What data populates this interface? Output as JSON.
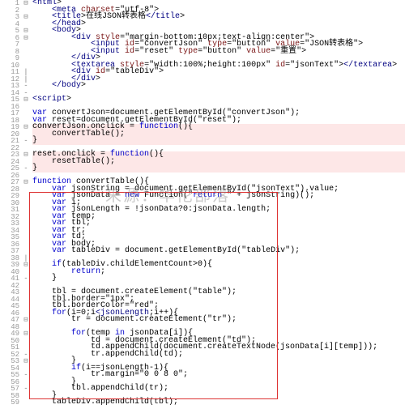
{
  "watermark": "来源：华佗部落",
  "gutter_max": 59,
  "fold_markers": {
    "1": "⊟",
    "3": "⊟",
    "5": "⊟",
    "6": "⊟",
    "11": "|",
    "12": "|",
    "13": "-",
    "14": "-",
    "15": "⊟",
    "19": "⊟",
    "21": "-",
    "23": "⊟",
    "25": "-",
    "27": "⊟",
    "38": "|",
    "39": "⊟",
    "41": "-",
    "47": "⊟",
    "49": "⊟",
    "52": "-",
    "53": "⊟",
    "55": "-",
    "57": "-"
  },
  "highlight_lines": [
    19,
    20,
    21,
    23,
    24,
    25
  ],
  "code": {
    "1": "<html>",
    "2": "    <meta charset=\"utf-8\">",
    "3": "    <title>在线JSON转表格</title>",
    "4": "    </head>",
    "5": "    <body>",
    "6": "        <div style=\"margin-bottom:10px;text-align:center\">",
    "7": "            <input id=\"convertJson\" type=\"button\" value=\"JSON转表格\">",
    "8": "            <input id=\"reset\" type=\"button\" value=\"重置\">",
    "9": "        </div>",
    "10": "        <textarea style=\"width:100%;height:100px\" id=\"jsonText\"></textarea>",
    "11": "        <div id=\"tableDiv\">",
    "12": "        </div>",
    "13": "    </body>",
    "14": "",
    "15": "<script>",
    "16": "",
    "17": "var convertJson=document.getElementById(\"convertJson\");",
    "18": "var reset=document.getElementById(\"reset\");",
    "19": "convertJson.onclick = function(){",
    "20": "    convertTable();",
    "21": "}",
    "22": "",
    "23": "reset.onclick = function(){",
    "24": "    resetTable();",
    "25": "}",
    "26": "",
    "27": "function convertTable(){",
    "28": "    var jsonString = document.getElementById(\"jsonText\").value;",
    "29": "    var jsonData = new Function(\"return \" + jsonString)();",
    "30": "    var i;",
    "31": "    var jsonLength = !jsonData?0:jsonData.length;",
    "32": "    var temp;",
    "33": "    var tbl;",
    "34": "    var tr;",
    "35": "    var td;",
    "36": "    var body;",
    "37": "    var tableDiv = document.getElementById(\"tableDiv\");",
    "38": "",
    "39": "    if(tableDiv.childElementCount>0){",
    "40": "        return;",
    "41": "    }",
    "42": "",
    "43": "    tbl = document.createElement(\"table\");",
    "44": "    tbl.border=\"1px\";",
    "45": "    tbl.borderColor=\"red\";",
    "46": "    for(i=0;i<jsonLength;i++){",
    "47": "        tr = document.createElement(\"tr\");",
    "48": "",
    "49": "        for(temp in jsonData[i]){",
    "50": "            td = document.createElement(\"td\");",
    "51": "            td.appendChild(document.createTextNode(jsonData[i][temp]));",
    "52": "            tr.appendChild(td);",
    "53": "        }",
    "54": "        if(i==jsonLength-1){",
    "55": "            tr.margin=\"0 0 8 0\";",
    "56": "        }",
    "57": "        tbl.appendChild(tr);",
    "58": "    }",
    "59": "    tableDiv.appendChild(tbl);"
  }
}
